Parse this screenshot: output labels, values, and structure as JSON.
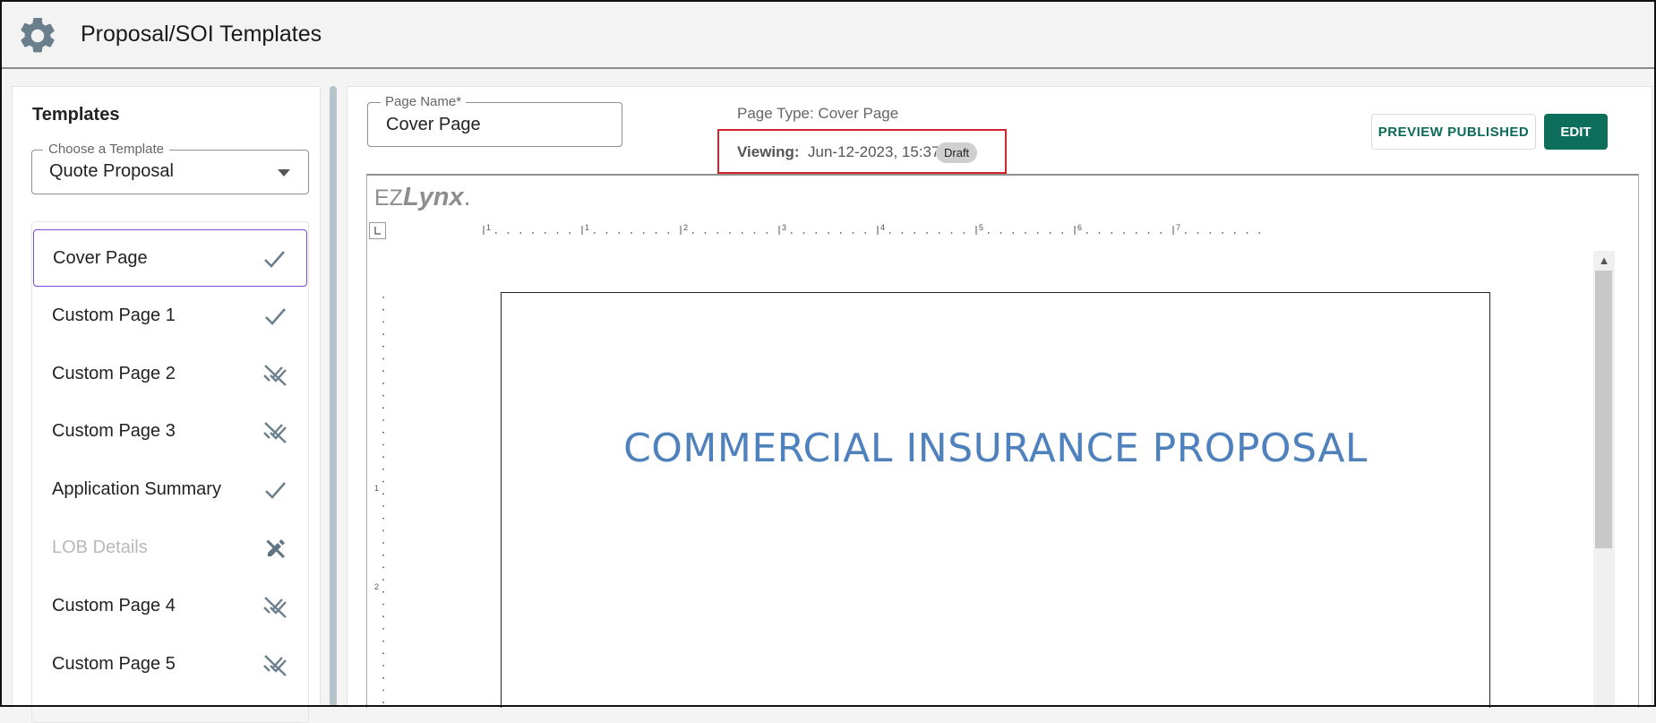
{
  "header": {
    "title": "Proposal/SOI Templates",
    "icon": "gear-icon"
  },
  "templates": {
    "heading": "Templates",
    "select": {
      "legend": "Choose a Template",
      "value": "Quote Proposal"
    },
    "pages": [
      {
        "label": "Cover Page",
        "status": "check",
        "selected": true,
        "disabled": false
      },
      {
        "label": "Custom Page 1",
        "status": "check",
        "selected": false,
        "disabled": false
      },
      {
        "label": "Custom Page 2",
        "status": "unchecked",
        "selected": false,
        "disabled": false
      },
      {
        "label": "Custom Page 3",
        "status": "unchecked",
        "selected": false,
        "disabled": false
      },
      {
        "label": "Application Summary",
        "status": "check",
        "selected": false,
        "disabled": false
      },
      {
        "label": "LOB Details",
        "status": "not-editable",
        "selected": false,
        "disabled": true
      },
      {
        "label": "Custom Page 4",
        "status": "unchecked",
        "selected": false,
        "disabled": false
      },
      {
        "label": "Custom Page 5",
        "status": "unchecked",
        "selected": false,
        "disabled": false
      }
    ]
  },
  "editor_header": {
    "page_name_legend": "Page Name*",
    "page_name_value": "Cover Page",
    "page_type": "Page Type: Cover Page",
    "viewing_label": "Viewing:",
    "viewing_date": "Jun-12-2023, 15:37",
    "draft_badge": "Draft",
    "preview_button": "PREVIEW PUBLISHED",
    "edit_button": "EDIT"
  },
  "document": {
    "logo_prefix": "EZ",
    "logo_name": "Lynx",
    "logo_suffix": ".",
    "title": "COMMERCIAL INSURANCE PROPOSAL",
    "ruler_numbers": [
      "1",
      "1",
      "2",
      "3",
      "4",
      "5",
      "6",
      "7"
    ],
    "vruler_numbers": [
      "1",
      "2"
    ]
  },
  "colors": {
    "accent_green": "#0e6e5c",
    "selected_border": "#7b4bd9",
    "viewing_highlight": "#d4242e",
    "doc_title": "#4f81bd"
  }
}
